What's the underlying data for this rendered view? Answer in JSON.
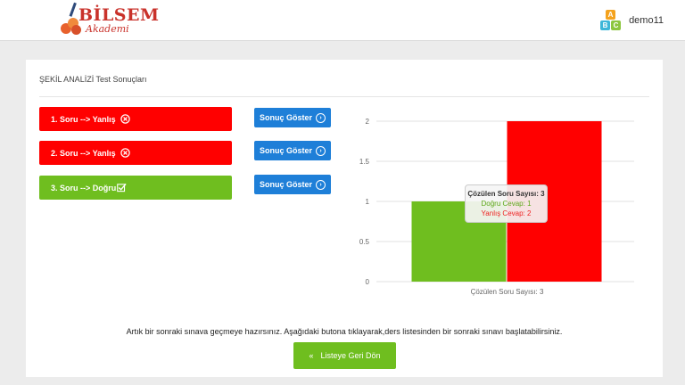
{
  "header": {
    "logo_text": "BİLSEM",
    "logo_sub": "Akademi",
    "username": "demo11"
  },
  "card": {
    "title": "ŞEKİL ANALİZİ Test Sonuçları"
  },
  "results": [
    {
      "label": "1. Soru   --> Yanlış",
      "status": "wrong"
    },
    {
      "label": "2. Soru   --> Yanlış",
      "status": "wrong"
    },
    {
      "label": "3. Soru   --> Doğru",
      "status": "correct"
    }
  ],
  "show_button_label": "Sonuç Göster",
  "chart_data": {
    "type": "bar",
    "categories": [
      "Çözülen Soru Sayısı: 3"
    ],
    "series": [
      {
        "name": "Doğru Cevap",
        "values": [
          1
        ],
        "color": "#6fbe1f"
      },
      {
        "name": "Yanlış Cevap",
        "values": [
          2
        ],
        "color": "#ff0000"
      }
    ],
    "y_ticks": [
      "0",
      "0.5",
      "1",
      "1.5",
      "2"
    ],
    "ylim": [
      0,
      2
    ],
    "grid": true
  },
  "tooltip": {
    "title": "Çözülen Soru Sayısı: 3",
    "correct": "Doğru Cevap: 1",
    "wrong": "Yanlış Cevap: 2"
  },
  "footer": {
    "message": "Artık bir sonraki sınava geçmeye hazırsınız. Aşağıdaki butona tıklayarak,ders listesinden bir sonraki sınavı başlatabilirsiniz.",
    "back_button_label": "Listeye Geri Dön"
  }
}
